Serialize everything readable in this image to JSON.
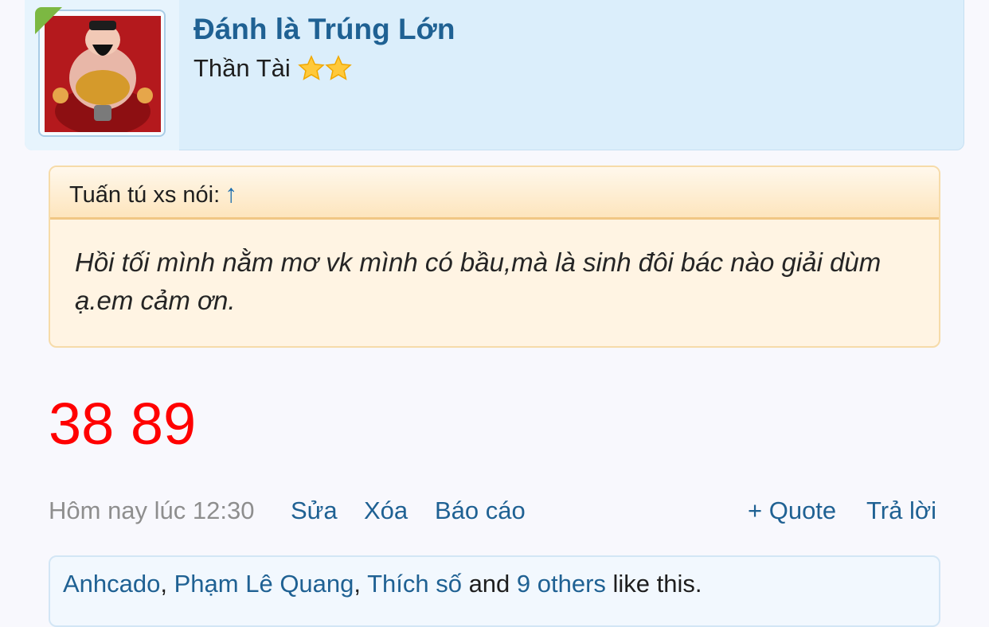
{
  "user": {
    "name": "Đánh là Trúng Lớn",
    "title": "Thần Tài",
    "star_count": 2
  },
  "quote": {
    "author": "Tuấn tú xs nói:",
    "jump_arrow": "↑",
    "text": "Hồi tối mình nằm mơ vk mình có bầu,mà là sinh đôi bác nào giải dùm ạ.em cảm ơn."
  },
  "post": {
    "numbers": "38 89"
  },
  "meta": {
    "timestamp": "Hôm nay lúc 12:30",
    "edit_label": "Sửa",
    "delete_label": "Xóa",
    "report_label": "Báo cáo",
    "quote_label": "+ Quote",
    "reply_label": "Trả lời"
  },
  "likes": {
    "users": [
      "Anhcado",
      "Phạm Lê Quang",
      "Thích số"
    ],
    "sep": ", ",
    "and": " and ",
    "others": "9 others",
    "suffix": " like this."
  },
  "colors": {
    "link": "#1f6193",
    "numbers": "#ff0000",
    "header_bg": "#dbeefb",
    "quote_bg": "#fff4e3"
  }
}
